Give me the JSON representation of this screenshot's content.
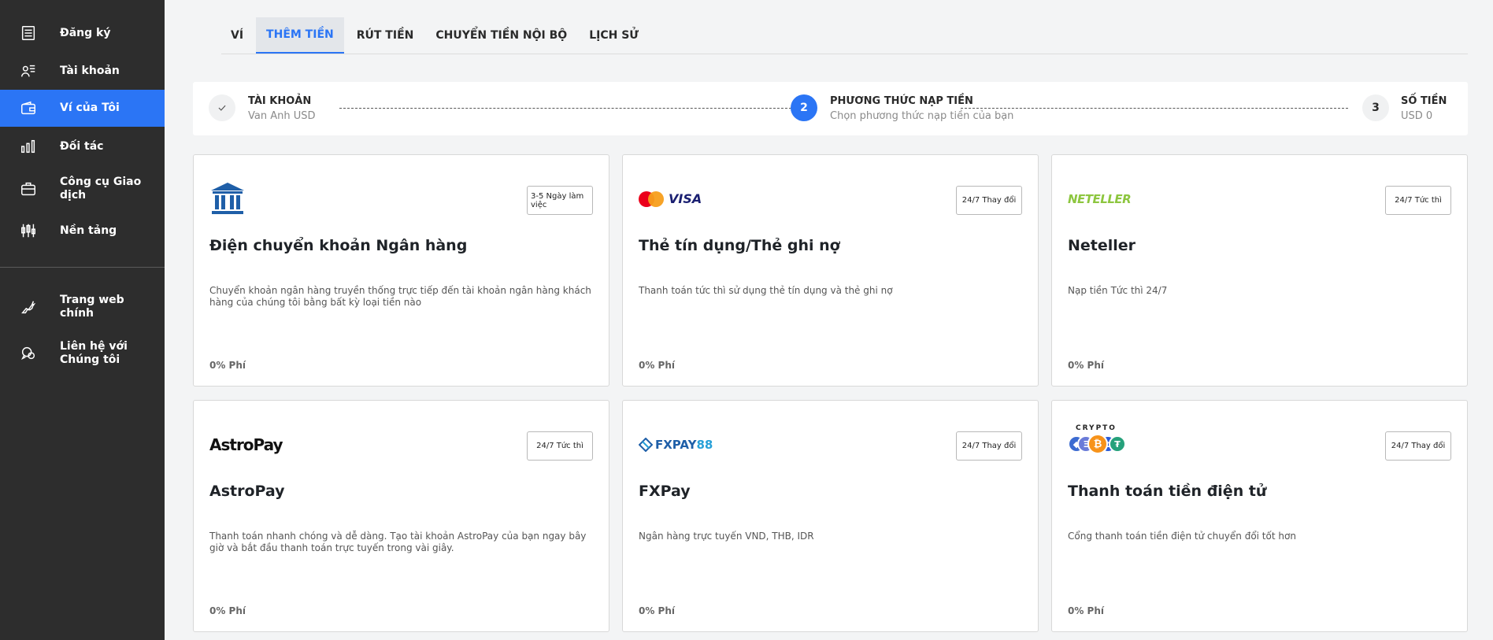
{
  "sidebar": {
    "items": [
      {
        "label": "Đăng ký",
        "icon": "register-icon"
      },
      {
        "label": "Tài khoản",
        "icon": "account-icon"
      },
      {
        "label": "Ví của Tôi",
        "icon": "wallet-icon",
        "active": true
      },
      {
        "label": "Đối tác",
        "icon": "partner-icon"
      },
      {
        "label": "Công cụ Giao dịch",
        "icon": "briefcase-icon"
      },
      {
        "label": "Nền tảng",
        "icon": "platform-icon"
      }
    ],
    "secondary": [
      {
        "label": "Trang web chính",
        "icon": "bull-icon"
      },
      {
        "label": "Liên hệ với Chúng tôi",
        "icon": "chat-icon"
      }
    ]
  },
  "tabs": [
    {
      "label": "VÍ"
    },
    {
      "label": "THÊM TIỀN",
      "active": true
    },
    {
      "label": "RÚT TIỀN"
    },
    {
      "label": "CHUYỂN TIỀN NỘI BỘ"
    },
    {
      "label": "LỊCH SỬ"
    }
  ],
  "stepper": {
    "steps": [
      {
        "number": "✓",
        "title": "TÀI KHOẢN",
        "subtitle": "Van Anh USD",
        "state": "done"
      },
      {
        "number": "2",
        "title": "PHƯƠNG THỨC NẠP TIỀN",
        "subtitle": "Chọn phương thức nạp tiền của bạn",
        "state": "current"
      },
      {
        "number": "3",
        "title": "SỐ TIỀN",
        "subtitle": "USD 0",
        "state": "todo"
      }
    ]
  },
  "methods": [
    {
      "title": "Điện chuyển khoản Ngân hàng",
      "badge": "3-5 Ngày làm việc",
      "description": "Chuyển khoản ngân hàng truyền thống trực tiếp đến tài khoản ngân hàng khách hàng của chúng tôi bằng bất kỳ loại tiền nào",
      "fee": "0% Phí",
      "logo": "bank-icon"
    },
    {
      "title": "Thẻ tín dụng/Thẻ ghi nợ",
      "badge": "24/7 Thay đổi",
      "description": "Thanh toán tức thì sử dụng thẻ tín dụng và thẻ ghi nợ",
      "fee": "0% Phí",
      "logo": "mastercard-visa-logo",
      "logo_text": "VISA"
    },
    {
      "title": "Neteller",
      "badge": "24/7 Tức thì",
      "description": "Nạp tiền Tức thì 24/7",
      "fee": "0% Phí",
      "logo": "neteller-logo",
      "logo_text": "NETELLER"
    },
    {
      "title": "AstroPay",
      "badge": "24/7 Tức thì",
      "description": "Thanh toán nhanh chóng và dễ dàng. Tạo tài khoản AstroPay của bạn ngay bây giờ và bắt đầu thanh toán trực tuyến trong vài giây.",
      "fee": "0% Phí",
      "logo": "astropay-logo",
      "logo_text": "AstroPay"
    },
    {
      "title": "FXPay",
      "badge": "24/7 Thay đổi",
      "description": "Ngân hàng trực tuyến VND, THB, IDR",
      "fee": "0% Phí",
      "logo": "fxpay-logo",
      "logo_text": "FXPAY",
      "logo_num": "88"
    },
    {
      "title": "Thanh toán tiền điện tử",
      "badge": "24/7 Thay đổi",
      "description": "Cổng thanh toán tiền điện tử chuyển đổi tốt hơn",
      "fee": "0% Phí",
      "logo": "crypto-logo",
      "logo_text": "CRYPTO"
    }
  ],
  "colors": {
    "accent": "#2b75f5",
    "sidebar": "#2d2d2d"
  }
}
